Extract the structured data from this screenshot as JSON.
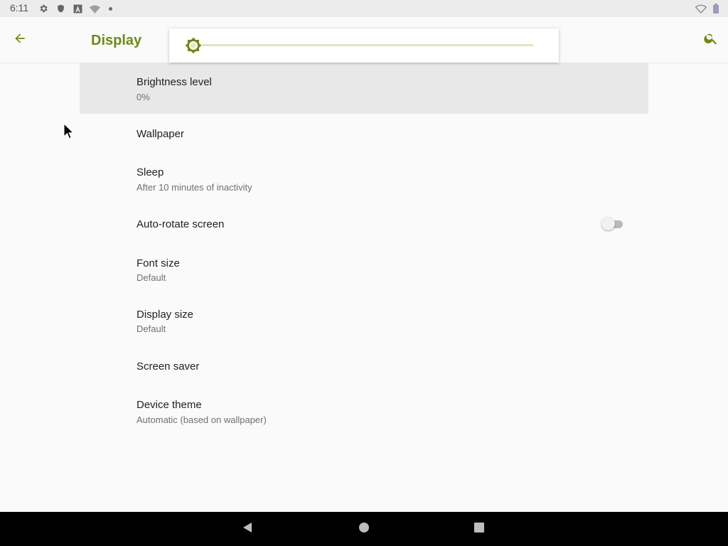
{
  "status_bar": {
    "time": "6:11",
    "icons": [
      "settings-icon",
      "shield-icon",
      "a-letter-icon",
      "wifi-unknown-icon",
      "dot-icon",
      "wifi-signal-icon",
      "battery-icon"
    ]
  },
  "app_bar": {
    "title": "Display",
    "back_icon": "arrow-back-icon",
    "search_icon": "search-icon"
  },
  "brightness_slider": {
    "level_percent": 0,
    "icon": "brightness-icon"
  },
  "settings": [
    {
      "title": "Brightness level",
      "subtitle": "0%"
    },
    {
      "title": "Wallpaper",
      "subtitle": ""
    },
    {
      "title": "Sleep",
      "subtitle": "After 10 minutes of inactivity"
    },
    {
      "title": "Auto-rotate screen",
      "subtitle": "",
      "toggle_on": false
    },
    {
      "title": "Font size",
      "subtitle": "Default"
    },
    {
      "title": "Display size",
      "subtitle": "Default"
    },
    {
      "title": "Screen saver",
      "subtitle": ""
    },
    {
      "title": "Device theme",
      "subtitle": "Automatic (based on wallpaper)"
    }
  ],
  "colors": {
    "accent": "#6f8a16",
    "background": "#fafafa",
    "highlight": "#e8e8e8",
    "nav_bar": "#000000"
  },
  "nav_bar": {
    "icons": [
      "nav-back-icon",
      "nav-home-icon",
      "nav-recents-icon"
    ]
  }
}
